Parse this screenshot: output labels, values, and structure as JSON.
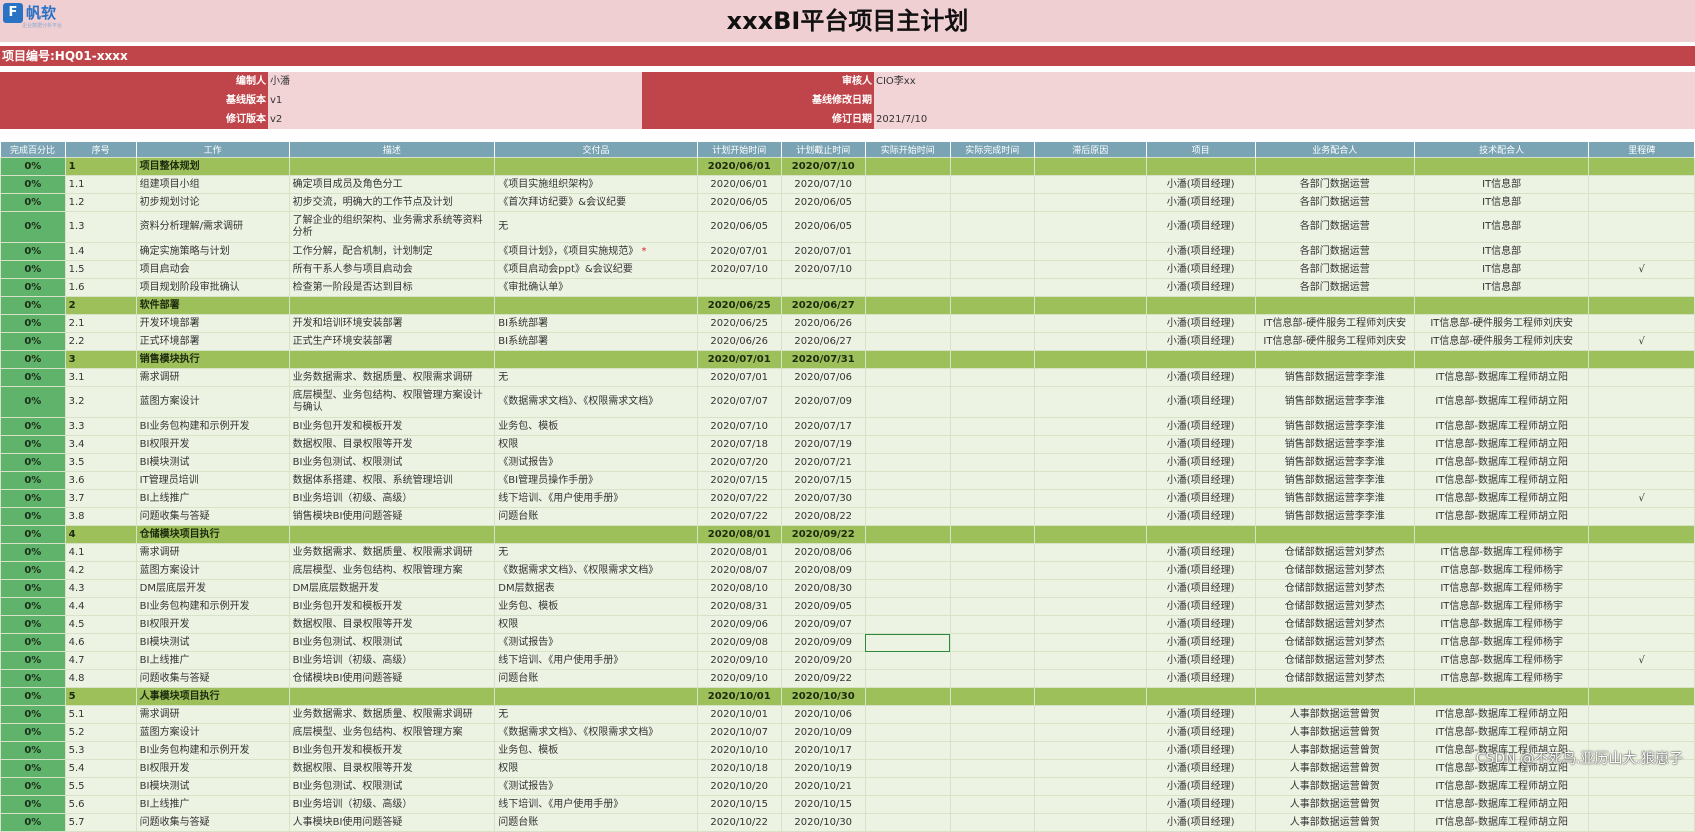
{
  "logo": {
    "mark": "F",
    "text": "帆软",
    "sub": "企业数据分析平台"
  },
  "title": "xxxBI平台项目主计划",
  "project_code": "项目编号:HQ01-xxxx",
  "meta": {
    "left": [
      {
        "label": "编制人",
        "value": "小潘"
      },
      {
        "label": "基线版本",
        "value": "v1"
      },
      {
        "label": "修订版本",
        "value": "v2"
      }
    ],
    "right": [
      {
        "label": "审核人",
        "value": "CIO李xx"
      },
      {
        "label": "基线修改日期",
        "value": ""
      },
      {
        "label": "修订日期",
        "value": "2021/7/10"
      }
    ]
  },
  "columns": [
    "完成百分比",
    "序号",
    "工作",
    "描述",
    "交付品",
    "计划开始时间",
    "计划截止时间",
    "实际开始时间",
    "实际完成时间",
    "滞后原因",
    "项目",
    "业务配合人",
    "技术配合人",
    "里程碑"
  ],
  "rows": [
    {
      "p": "0%",
      "n": "1",
      "w": "项目整体规划",
      "s": "2020/06/01",
      "e": "2020/07/10",
      "phase": true
    },
    {
      "p": "0%",
      "n": "1.1",
      "w": "组建项目小组",
      "d": "确定项目成员及角色分工",
      "o": "《项目实施组织架构》",
      "s": "2020/06/01",
      "e": "2020/07/10",
      "x": "小潘(项目经理)",
      "b": "各部门数据运营",
      "t": "IT信息部"
    },
    {
      "p": "0%",
      "n": "1.2",
      "w": "初步规划讨论",
      "d": "初步交流，明确大的工作节点及计划",
      "o": "《首次拜访纪要》&会议纪要",
      "s": "2020/06/05",
      "e": "2020/06/05",
      "x": "小潘(项目经理)",
      "b": "各部门数据运营",
      "t": "IT信息部"
    },
    {
      "p": "0%",
      "n": "1.3",
      "w": "资料分析理解/需求调研",
      "d": "了解企业的组织架构、业务需求系统等资料分析",
      "o": "无",
      "s": "2020/06/05",
      "e": "2020/06/05",
      "x": "小潘(项目经理)",
      "b": "各部门数据运营",
      "t": "IT信息部",
      "tall": true
    },
    {
      "p": "0%",
      "n": "1.4",
      "w": "确定实施策略与计划",
      "d": "工作分解，配合机制，计划制定",
      "o": "《项目计划》，《项目实施规范》",
      "star": "*",
      "s": "2020/07/01",
      "e": "2020/07/01",
      "x": "小潘(项目经理)",
      "b": "各部门数据运营",
      "t": "IT信息部"
    },
    {
      "p": "0%",
      "n": "1.5",
      "w": "项目启动会",
      "d": "所有干系人参与项目启动会",
      "o": "《项目启动会ppt》&会议纪要",
      "s": "2020/07/10",
      "e": "2020/07/10",
      "x": "小潘(项目经理)",
      "b": "各部门数据运营",
      "t": "IT信息部",
      "m": "√"
    },
    {
      "p": "0%",
      "n": "1.6",
      "w": "项目规划阶段审批确认",
      "d": "检查第一阶段是否达到目标",
      "o": "《审批确认单》",
      "s": "",
      "e": "",
      "x": "小潘(项目经理)",
      "b": "各部门数据运营",
      "t": "IT信息部"
    },
    {
      "p": "0%",
      "n": "2",
      "w": "软件部署",
      "s": "2020/06/25",
      "e": "2020/06/27",
      "phase": true
    },
    {
      "p": "0%",
      "n": "2.1",
      "w": "开发环境部署",
      "d": "开发和培训环境安装部署",
      "o": "BI系统部署",
      "s": "2020/06/25",
      "e": "2020/06/26",
      "x": "小潘(项目经理)",
      "b": "IT信息部-硬件服务工程师刘庆安",
      "t": "IT信息部-硬件服务工程师刘庆安"
    },
    {
      "p": "0%",
      "n": "2.2",
      "w": "正式环境部署",
      "d": "正式生产环境安装部署",
      "o": "BI系统部署",
      "s": "2020/06/26",
      "e": "2020/06/27",
      "x": "小潘(项目经理)",
      "b": "IT信息部-硬件服务工程师刘庆安",
      "t": "IT信息部-硬件服务工程师刘庆安",
      "m": "√"
    },
    {
      "p": "0%",
      "n": "3",
      "w": "销售模块执行",
      "s": "2020/07/01",
      "e": "2020/07/31",
      "phase": true
    },
    {
      "p": "0%",
      "n": "3.1",
      "w": "需求调研",
      "d": "业务数据需求、数据质量、权限需求调研",
      "o": "无",
      "s": "2020/07/01",
      "e": "2020/07/06",
      "x": "小潘(项目经理)",
      "b": "销售部数据运营李李淮",
      "t": "IT信息部-数据库工程师胡立阳"
    },
    {
      "p": "0%",
      "n": "3.2",
      "w": "蓝图方案设计",
      "d": "底层模型、业务包结构、权限管理方案设计与确认",
      "o": "《数据需求文档》、《权限需求文档》",
      "s": "2020/07/07",
      "e": "2020/07/09",
      "x": "小潘(项目经理)",
      "b": "销售部数据运营李李淮",
      "t": "IT信息部-数据库工程师胡立阳",
      "tall": true
    },
    {
      "p": "0%",
      "n": "3.3",
      "w": "BI业务包构建和示例开发",
      "d": "BI业务包开发和模板开发",
      "o": "业务包、模板",
      "s": "2020/07/10",
      "e": "2020/07/17",
      "x": "小潘(项目经理)",
      "b": "销售部数据运营李李淮",
      "t": "IT信息部-数据库工程师胡立阳"
    },
    {
      "p": "0%",
      "n": "3.4",
      "w": "BI权限开发",
      "d": "数据权限、目录权限等开发",
      "o": "权限",
      "s": "2020/07/18",
      "e": "2020/07/19",
      "x": "小潘(项目经理)",
      "b": "销售部数据运营李李淮",
      "t": "IT信息部-数据库工程师胡立阳"
    },
    {
      "p": "0%",
      "n": "3.5",
      "w": "BI模块测试",
      "d": "BI业务包测试、权限测试",
      "o": "《测试报告》",
      "s": "2020/07/20",
      "e": "2020/07/21",
      "x": "小潘(项目经理)",
      "b": "销售部数据运营李李淮",
      "t": "IT信息部-数据库工程师胡立阳"
    },
    {
      "p": "0%",
      "n": "3.6",
      "w": "IT管理员培训",
      "d": "数据体系搭建、权限、系统管理培训",
      "o": "《BI管理员操作手册》",
      "s": "2020/07/15",
      "e": "2020/07/15",
      "x": "小潘(项目经理)",
      "b": "销售部数据运营李李淮",
      "t": "IT信息部-数据库工程师胡立阳"
    },
    {
      "p": "0%",
      "n": "3.7",
      "w": "BI上线推广",
      "d": "BI业务培训（初级、高级）",
      "o": "线下培训、《用户使用手册》",
      "s": "2020/07/22",
      "e": "2020/07/30",
      "x": "小潘(项目经理)",
      "b": "销售部数据运营李李淮",
      "t": "IT信息部-数据库工程师胡立阳",
      "m": "√"
    },
    {
      "p": "0%",
      "n": "3.8",
      "w": "问题收集与答疑",
      "d": "销售模块BI使用问题答疑",
      "o": "问题台账",
      "s": "2020/07/22",
      "e": "2020/08/22",
      "x": "小潘(项目经理)",
      "b": "销售部数据运营李李淮",
      "t": "IT信息部-数据库工程师胡立阳"
    },
    {
      "p": "0%",
      "n": "4",
      "w": "仓储模块项目执行",
      "s": "2020/08/01",
      "e": "2020/09/22",
      "phase": true
    },
    {
      "p": "0%",
      "n": "4.1",
      "w": "需求调研",
      "d": "业务数据需求、数据质量、权限需求调研",
      "o": "无",
      "s": "2020/08/01",
      "e": "2020/08/06",
      "x": "小潘(项目经理)",
      "b": "仓储部数据运营刘梦杰",
      "t": "IT信息部-数据库工程师杨宇"
    },
    {
      "p": "0%",
      "n": "4.2",
      "w": "蓝图方案设计",
      "d": "底层模型、业务包结构、权限管理方案",
      "o": "《数据需求文档》、《权限需求文档》",
      "s": "2020/08/07",
      "e": "2020/08/09",
      "x": "小潘(项目经理)",
      "b": "仓储部数据运营刘梦杰",
      "t": "IT信息部-数据库工程师杨宇"
    },
    {
      "p": "0%",
      "n": "4.3",
      "w": "DM层底层开发",
      "d": "DM层底层数据开发",
      "o": "DM层数据表",
      "s": "2020/08/10",
      "e": "2020/08/30",
      "x": "小潘(项目经理)",
      "b": "仓储部数据运营刘梦杰",
      "t": "IT信息部-数据库工程师杨宇"
    },
    {
      "p": "0%",
      "n": "4.4",
      "w": "BI业务包构建和示例开发",
      "d": "BI业务包开发和模板开发",
      "o": "业务包、模板",
      "s": "2020/08/31",
      "e": "2020/09/05",
      "x": "小潘(项目经理)",
      "b": "仓储部数据运营刘梦杰",
      "t": "IT信息部-数据库工程师杨宇"
    },
    {
      "p": "0%",
      "n": "4.5",
      "w": "BI权限开发",
      "d": "数据权限、目录权限等开发",
      "o": "权限",
      "s": "2020/09/06",
      "e": "2020/09/07",
      "x": "小潘(项目经理)",
      "b": "仓储部数据运营刘梦杰",
      "t": "IT信息部-数据库工程师杨宇"
    },
    {
      "p": "0%",
      "n": "4.6",
      "w": "BI模块测试",
      "d": "BI业务包测试、权限测试",
      "o": "《测试报告》",
      "s": "2020/09/08",
      "e": "2020/09/09",
      "x": "小潘(项目经理)",
      "b": "仓储部数据运营刘梦杰",
      "t": "IT信息部-数据库工程师杨宇",
      "sel": true
    },
    {
      "p": "0%",
      "n": "4.7",
      "w": "BI上线推广",
      "d": "BI业务培训（初级、高级）",
      "o": "线下培训、《用户使用手册》",
      "s": "2020/09/10",
      "e": "2020/09/20",
      "x": "小潘(项目经理)",
      "b": "仓储部数据运营刘梦杰",
      "t": "IT信息部-数据库工程师杨宇",
      "m": "√"
    },
    {
      "p": "0%",
      "n": "4.8",
      "w": "问题收集与答疑",
      "d": "仓储模块BI使用问题答疑",
      "o": "问题台账",
      "s": "2020/09/10",
      "e": "2020/09/22",
      "x": "小潘(项目经理)",
      "b": "仓储部数据运营刘梦杰",
      "t": "IT信息部-数据库工程师杨宇"
    },
    {
      "p": "0%",
      "n": "5",
      "w": "人事模块项目执行",
      "s": "2020/10/01",
      "e": "2020/10/30",
      "phase": true
    },
    {
      "p": "0%",
      "n": "5.1",
      "w": "需求调研",
      "d": "业务数据需求、数据质量、权限需求调研",
      "o": "无",
      "s": "2020/10/01",
      "e": "2020/10/06",
      "x": "小潘(项目经理)",
      "b": "人事部数据运营曾贺",
      "t": "IT信息部-数据库工程师胡立阳"
    },
    {
      "p": "0%",
      "n": "5.2",
      "w": "蓝图方案设计",
      "d": "底层模型、业务包结构、权限管理方案",
      "o": "《数据需求文档》、《权限需求文档》",
      "s": "2020/10/07",
      "e": "2020/10/09",
      "x": "小潘(项目经理)",
      "b": "人事部数据运营曾贺",
      "t": "IT信息部-数据库工程师胡立阳"
    },
    {
      "p": "0%",
      "n": "5.3",
      "w": "BI业务包构建和示例开发",
      "d": "BI业务包开发和模板开发",
      "o": "业务包、模板",
      "s": "2020/10/10",
      "e": "2020/10/17",
      "x": "小潘(项目经理)",
      "b": "人事部数据运营曾贺",
      "t": "IT信息部-数据库工程师胡立阳"
    },
    {
      "p": "0%",
      "n": "5.4",
      "w": "BI权限开发",
      "d": "数据权限、目录权限等开发",
      "o": "权限",
      "s": "2020/10/18",
      "e": "2020/10/19",
      "x": "小潘(项目经理)",
      "b": "人事部数据运营曾贺",
      "t": "IT信息部-数据库工程师胡立阳"
    },
    {
      "p": "0%",
      "n": "5.5",
      "w": "BI模块测试",
      "d": "BI业务包测试、权限测试",
      "o": "《测试报告》",
      "s": "2020/10/20",
      "e": "2020/10/21",
      "x": "小潘(项目经理)",
      "b": "人事部数据运营曾贺",
      "t": "IT信息部-数据库工程师胡立阳"
    },
    {
      "p": "0%",
      "n": "5.6",
      "w": "BI上线推广",
      "d": "BI业务培训（初级、高级）",
      "o": "线下培训、《用户使用手册》",
      "s": "2020/10/15",
      "e": "2020/10/15",
      "x": "小潘(项目经理)",
      "b": "人事部数据运营曾贺",
      "t": "IT信息部-数据库工程师胡立阳"
    },
    {
      "p": "0%",
      "n": "5.7",
      "w": "问题收集与答疑",
      "d": "人事模块BI使用问题答疑",
      "o": "问题台账",
      "s": "2020/10/22",
      "e": "2020/10/30",
      "x": "小潘(项目经理)",
      "b": "人事部数据运营曾贺",
      "t": "IT信息部-数据库工程师胡立阳"
    }
  ],
  "watermark": "CSDN @不死鸟.亚历山大.狼崽子"
}
